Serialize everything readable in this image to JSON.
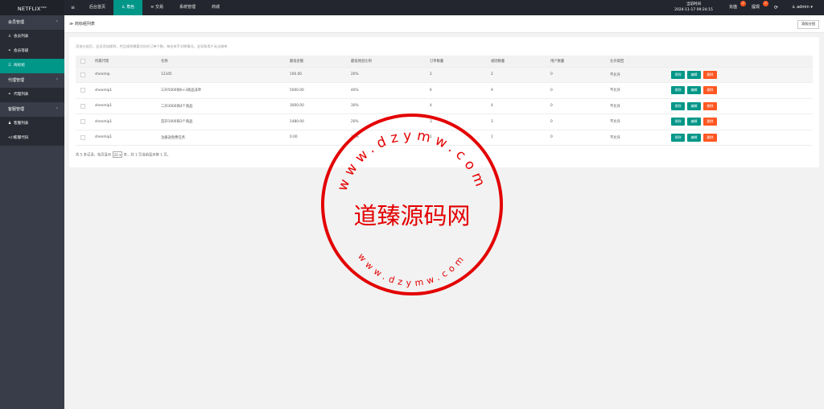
{
  "app": {
    "logo": "NETFLIX",
    "logo_sup": "VOD"
  },
  "topnav": {
    "menu_icon": "≡",
    "items": [
      {
        "label": "后台首页",
        "active": false
      },
      {
        "label": "角色",
        "icon": "♙",
        "active": true
      },
      {
        "label": "交易",
        "icon": "≋",
        "active": false
      },
      {
        "label": "系统管理",
        "active": false
      },
      {
        "label": "商城",
        "active": false
      }
    ]
  },
  "header": {
    "server_time_label": "当前时间",
    "server_time_value": "2024-11-17 09:24:15",
    "recharge_label": "充值",
    "recharge_badge": "0",
    "withdraw_label": "提现",
    "withdraw_badge": "0",
    "refresh_icon": "⟳",
    "user_label": "admin",
    "user_icon": "♙",
    "caret_icon": "▾"
  },
  "sidebar": {
    "groups": [
      {
        "label": "会员管理",
        "items": [
          {
            "label": "会员列表",
            "icon": "♙",
            "active": false
          },
          {
            "label": "会员等级",
            "icon": "⚭",
            "active": false
          },
          {
            "label": "商标组",
            "icon": "☰",
            "active": true
          }
        ]
      },
      {
        "label": "代理管理",
        "items": [
          {
            "label": "代理列表",
            "icon": "⚭",
            "active": false
          }
        ]
      },
      {
        "label": "客服管理",
        "items": [
          {
            "label": "客服列表",
            "icon": "♟",
            "active": false
          },
          {
            "label": "客服代码",
            "icon": "</>",
            "active": false
          }
        ]
      }
    ]
  },
  "page": {
    "title": "商标组列表",
    "title_icon": "≫",
    "add_button": "添加分组",
    "tip": "添加分组后，会员添加规则，并且规则需要对应好订单个数，每台车不对称情况，会导致用户无法做单"
  },
  "table": {
    "headers": [
      "",
      "所属代理",
      "名称",
      "最低金额",
      "最低佣金比例",
      "订单数量",
      "规则数量",
      "用户数量",
      "允许取回",
      ""
    ],
    "rows": [
      [
        "shenmip",
        "12345",
        "100.00",
        "20%",
        "2",
        "2",
        "0",
        "不允许"
      ],
      [
        "shenmip1",
        "三开5000商6+3商品非单",
        "5000.00",
        "40%",
        "6",
        "9",
        "0",
        "不允许"
      ],
      [
        "shenmip1",
        "二开3000商4个商品",
        "3000.00",
        "30%",
        "4",
        "4",
        "0",
        "不允许"
      ],
      [
        "shenmip1",
        "首开1000商3个商品",
        "1480.00",
        "20%",
        "3",
        "3",
        "0",
        "不允许"
      ],
      [
        "shenmip1",
        "注册送免费任务",
        "0.00",
        "20%",
        "1",
        "1",
        "0",
        "不允许"
      ]
    ],
    "actions": {
      "rules": "规则",
      "edit": "编辑",
      "delete": "删除"
    }
  },
  "pager": {
    "prefix": "共 5 条记录，每页显示",
    "per_page": "20",
    "suffix": "条，共 1 页当前显示第 1 页。"
  },
  "watermark": {
    "center": "道臻源码网",
    "top_arc": "www.dzymw.com",
    "bottom_arc": "www.dzymw.com",
    "color": "#e30000"
  },
  "colors": {
    "accent": "#009688",
    "danger": "#ff5722",
    "topbar": "#23262e",
    "sidebar": "#393d49"
  }
}
